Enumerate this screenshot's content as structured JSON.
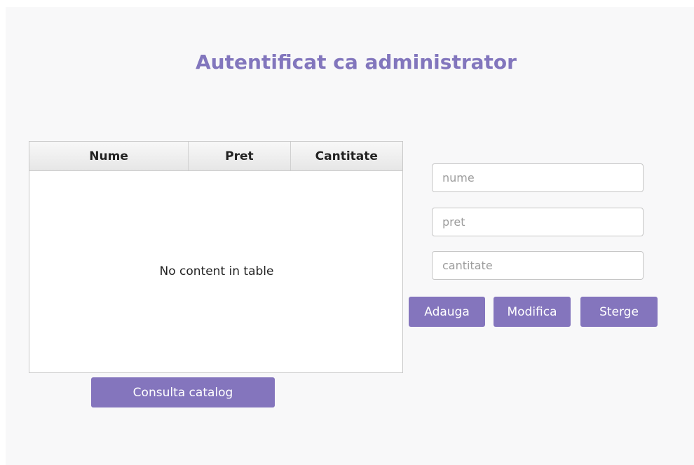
{
  "header": {
    "title": "Autentificat ca administrator"
  },
  "table": {
    "columns": [
      "Nume",
      "Pret",
      "Cantitate"
    ],
    "rows": [],
    "empty_text": "No content in table"
  },
  "form": {
    "name_placeholder": "nume",
    "price_placeholder": "pret",
    "quantity_placeholder": "cantitate",
    "name_value": "",
    "price_value": "",
    "quantity_value": ""
  },
  "buttons": {
    "add_label": "Adauga",
    "modify_label": "Modifica",
    "delete_label": "Sterge",
    "catalog_label": "Consulta catalog"
  },
  "colors": {
    "accent": "#8475bd",
    "title": "#8276bd",
    "background": "#f8f8f9"
  }
}
